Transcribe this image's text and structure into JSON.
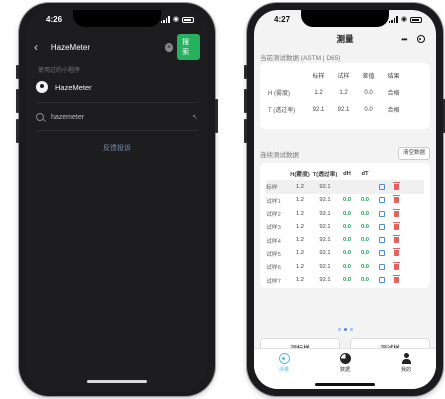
{
  "left_phone": {
    "status": {
      "time": "4:26"
    },
    "search": {
      "value": "HazeMeter",
      "button_label": "搜索"
    },
    "recent_section_label": "使用过的小程序",
    "recent_app": {
      "name": "HazeMeter"
    },
    "query_suggestion": "hazemeter",
    "feedback_link": "反馈投诉"
  },
  "right_phone": {
    "status": {
      "time": "4:27"
    },
    "nav_title": "测量",
    "current_section_title": "当前测试数据 (ASTM | D65)",
    "current_table": {
      "headers": [
        "",
        "标样",
        "试样",
        "差值",
        "结果"
      ],
      "rows": [
        {
          "label": "H (雾度)",
          "std": "1.2",
          "sample": "1.2",
          "diff": "0.0",
          "result": "合格"
        },
        {
          "label": "T (透过率)",
          "std": "92.1",
          "sample": "92.1",
          "diff": "0.0",
          "result": "合格"
        }
      ]
    },
    "history_section_title": "连续测试数据",
    "clear_button_label": "清空数据",
    "history_table": {
      "headers": [
        "",
        "H(雾度)",
        "T(透过率)",
        "dH",
        "dT"
      ],
      "rows": [
        {
          "label": "标样",
          "h": "1.2",
          "t": "92.1",
          "dh": "",
          "dt": ""
        },
        {
          "label": "试样1",
          "h": "1.2",
          "t": "92.1",
          "dh": "0.0",
          "dt": "0.0"
        },
        {
          "label": "试样2",
          "h": "1.2",
          "t": "92.1",
          "dh": "0.0",
          "dt": "0.0"
        },
        {
          "label": "试样3",
          "h": "1.2",
          "t": "92.1",
          "dh": "0.0",
          "dt": "0.0"
        },
        {
          "label": "试样4",
          "h": "1.2",
          "t": "92.1",
          "dh": "0.0",
          "dt": "0.0"
        },
        {
          "label": "试样5",
          "h": "1.2",
          "t": "92.1",
          "dh": "0.0",
          "dt": "0.0"
        },
        {
          "label": "试样6",
          "h": "1.2",
          "t": "92.1",
          "dh": "0.0",
          "dt": "0.0"
        },
        {
          "label": "试样7",
          "h": "1.2",
          "t": "92.1",
          "dh": "0.0",
          "dt": "0.0"
        }
      ]
    },
    "pager": {
      "count": 3,
      "active": 1
    },
    "buttons": {
      "measure_standard": "测标样",
      "measure_sample": "测试样"
    },
    "tabs": [
      {
        "label": "测量",
        "icon": "measure-icon",
        "active": true
      },
      {
        "label": "数据",
        "icon": "pie-chart-icon",
        "active": false
      },
      {
        "label": "我的",
        "icon": "user-icon",
        "active": false
      }
    ],
    "colors": {
      "pass": "#1fa15a",
      "accent": "#4fc1e8",
      "search_button": "#27b15f"
    }
  }
}
